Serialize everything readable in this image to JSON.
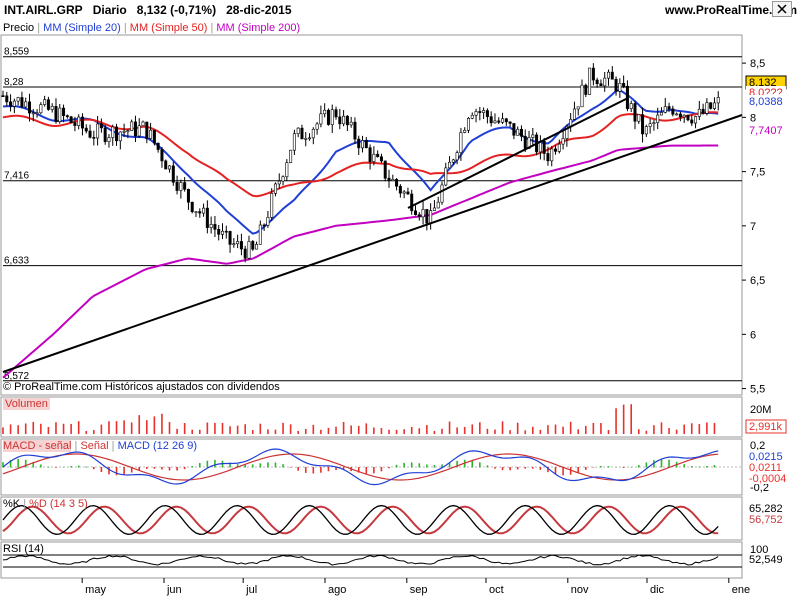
{
  "header": {
    "instrument": "INT.AIRL.GRP",
    "period": "Diario",
    "quote": "8,132 (-0,71%)",
    "date": "28-dic-2015",
    "website": "www.ProRealTime.com"
  },
  "close_icon": "close-x-icon",
  "price_panel": {
    "legend": {
      "precio": "Precio",
      "ma20": "MM (Simple 20)",
      "ma50": "MM (Simple 50)",
      "ma200": "MM (Simple 200)"
    },
    "footer": "© ProRealTime.com  Históricos ajustados con dividendos",
    "hlines": [
      {
        "value": 8.559,
        "label": "8,559"
      },
      {
        "value": 8.28,
        "label": "8,28"
      },
      {
        "value": 7.416,
        "label": "7,416"
      },
      {
        "value": 6.633,
        "label": "6,633"
      },
      {
        "value": 5.572,
        "label": "5,572"
      }
    ],
    "badges": {
      "last": {
        "value": 8.132,
        "label": "8,132",
        "bg": "#ffd300"
      },
      "ma50": {
        "value": 8.05,
        "label": "8,0???"
      },
      "ma20": {
        "value": 8.0388,
        "label": "8,0388"
      },
      "ma200": {
        "value": 7.7407,
        "label": "7,7407"
      }
    },
    "yticks": [
      "8,5",
      "8",
      "7,5",
      "7",
      "6,5",
      "6",
      "5,5"
    ]
  },
  "volume_panel": {
    "title": "Volumen",
    "tick": "20M",
    "badge": "2,991k"
  },
  "macd_panel": {
    "labels": [
      "MACD - señal",
      "Señal",
      "MACD (12 26 9)"
    ],
    "ticks": [
      "0,2",
      "-0,2"
    ],
    "badges": [
      "0,0215",
      "0,0211",
      "-0,0004"
    ]
  },
  "stoch_panel": {
    "labels": [
      "%K",
      "%D (14 3 5)"
    ],
    "badges": [
      "65,282",
      "56,752"
    ]
  },
  "rsi_panel": {
    "label": "RSI (14)",
    "tick": "100",
    "badge": "52,549"
  },
  "x_axis": {
    "months": [
      "may",
      "jun",
      "jul",
      "ago",
      "sep",
      "oct",
      "nov",
      "dic",
      "ene"
    ]
  },
  "colors": {
    "ma20": "#1f3fd6",
    "ma50": "#e52222",
    "ma200": "#c200c2",
    "trendline": "#000000",
    "volume": "#e8312a",
    "macd_up": "#2cb52c",
    "macd_down": "#e8312a",
    "stoch_k": "#000000",
    "stoch_d": "#c7393f"
  },
  "chart_data": {
    "type": "candlestick",
    "x": [
      "2015-04-01",
      "2015-04-20",
      "2015-05-05",
      "2015-05-25",
      "2015-06-10",
      "2015-06-25",
      "2015-07-05",
      "2015-07-20",
      "2015-08-05",
      "2015-08-25",
      "2015-09-10",
      "2015-09-25",
      "2015-10-10",
      "2015-10-25",
      "2015-11-10",
      "2015-11-20",
      "2015-11-30",
      "2015-12-10",
      "2015-12-20",
      "2015-12-28"
    ],
    "series": [
      {
        "name": "Precio",
        "values": [
          8.2,
          8.05,
          7.85,
          7.9,
          7.25,
          6.85,
          6.75,
          7.8,
          8.05,
          7.45,
          7.05,
          8.1,
          7.9,
          7.65,
          8.4,
          8.3,
          7.85,
          8.1,
          8.0,
          8.132
        ]
      },
      {
        "name": "MM (Simple 20)",
        "values": [
          8.1,
          8.0,
          7.95,
          7.8,
          7.5,
          7.1,
          6.95,
          7.2,
          7.7,
          7.8,
          7.3,
          7.8,
          7.9,
          7.75,
          8.1,
          8.25,
          8.05,
          8.1,
          8.0,
          8.0388
        ]
      },
      {
        "name": "MM (Simple 50)",
        "values": [
          8.0,
          7.95,
          7.95,
          7.9,
          7.7,
          7.4,
          7.3,
          7.35,
          7.5,
          7.6,
          7.45,
          7.55,
          7.65,
          7.7,
          7.85,
          8.0,
          8.0,
          8.0,
          8.0,
          8.05
        ]
      },
      {
        "name": "MM (Simple 200)",
        "values": [
          5.6,
          6.0,
          6.35,
          6.6,
          6.7,
          6.65,
          6.7,
          6.9,
          7.0,
          7.05,
          7.1,
          7.25,
          7.4,
          7.5,
          7.6,
          7.7,
          7.72,
          7.74,
          7.74,
          7.7407
        ]
      }
    ],
    "ylim": [
      5.45,
      8.75
    ]
  }
}
